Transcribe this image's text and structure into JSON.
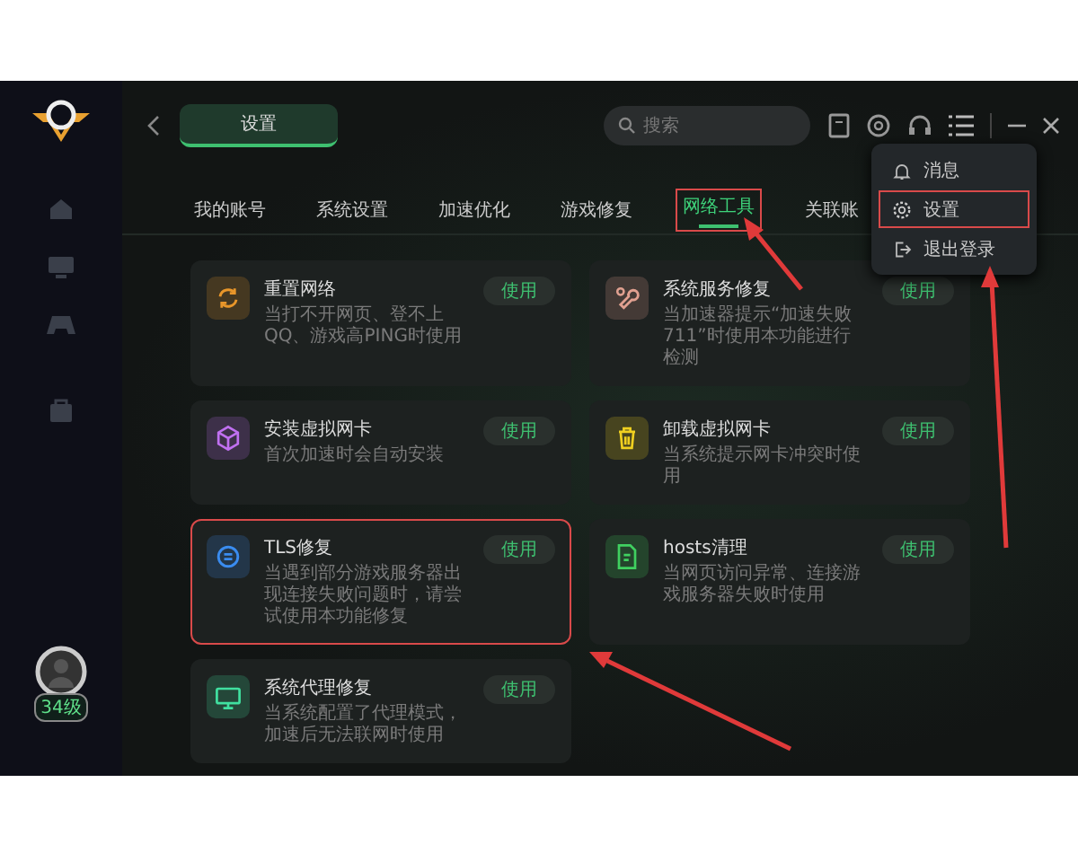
{
  "header": {
    "title": "设置",
    "search": {
      "placeholder": "搜索"
    }
  },
  "sidebar": {
    "level_badge": "34级"
  },
  "tabs": [
    {
      "label": "我的账号",
      "selected": false,
      "highlighted": false
    },
    {
      "label": "系统设置",
      "selected": false,
      "highlighted": false
    },
    {
      "label": "加速优化",
      "selected": false,
      "highlighted": false
    },
    {
      "label": "游戏修复",
      "selected": false,
      "highlighted": false
    },
    {
      "label": "网络工具",
      "selected": true,
      "highlighted": true
    },
    {
      "label": "关联账",
      "selected": false,
      "highlighted": false
    }
  ],
  "menu": [
    {
      "kind": "bell",
      "label": "消息",
      "highlighted": false
    },
    {
      "kind": "gear",
      "label": "设置",
      "highlighted": true
    },
    {
      "kind": "exit",
      "label": "退出登录",
      "highlighted": false
    }
  ],
  "tools": [
    {
      "kind": "refresh",
      "title": "重置网络",
      "description": "当打不开网页、登不上QQ、游戏高PING时使用",
      "button": "使用",
      "color": "#e8962a",
      "highlighted": false
    },
    {
      "kind": "wrench",
      "title": "系统服务修复",
      "description": "当加速器提示“加速失败711”时使用本功能进行检测",
      "button": "使用",
      "color": "#e0a090",
      "highlighted": false
    },
    {
      "kind": "cube",
      "title": "安装虚拟网卡",
      "description": "首次加速时会自动安装",
      "button": "使用",
      "color": "#c070f0",
      "highlighted": false
    },
    {
      "kind": "trash",
      "title": "卸载虚拟网卡",
      "description": "当系统提示网卡冲突时使用",
      "button": "使用",
      "color": "#f0d020",
      "highlighted": false
    },
    {
      "kind": "tls",
      "title": "TLS修复",
      "description": "当遇到部分游戏服务器出现连接失败问题时，请尝试使用本功能修复",
      "button": "使用",
      "color": "#3a8cf0",
      "highlighted": true
    },
    {
      "kind": "file",
      "title": "hosts清理",
      "description": "当网页访问异常、连接游戏服务器失败时使用",
      "button": "使用",
      "color": "#40d060",
      "highlighted": false
    },
    {
      "kind": "monitor",
      "title": "系统代理修复",
      "description": "当系统配置了代理模式，加速后无法联网时使用",
      "button": "使用",
      "color": "#40e0a0",
      "highlighted": false
    }
  ]
}
